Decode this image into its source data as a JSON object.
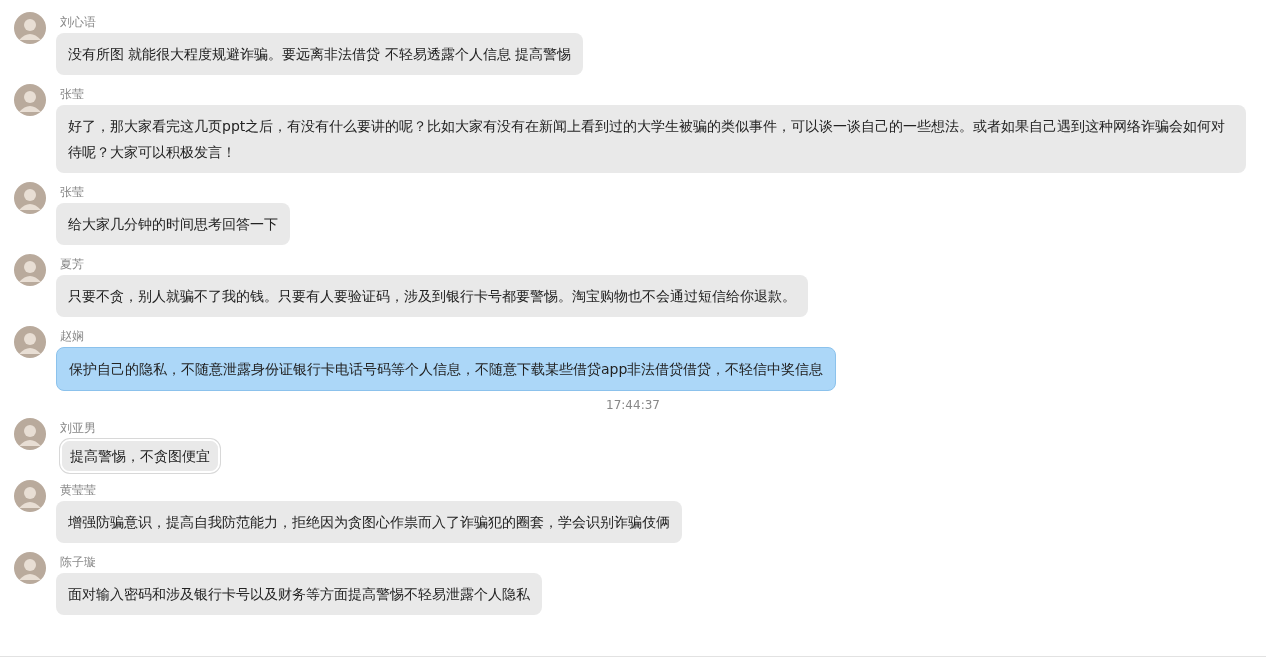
{
  "messages": [
    {
      "kind": "plain",
      "sender": "刘心语",
      "text": "没有所图 就能很大程度规避诈骗。要远离非法借贷 不轻易透露个人信息 提高警惕"
    },
    {
      "kind": "plain",
      "sender": "张莹",
      "text": "好了，那大家看完这几页ppt之后，有没有什么要讲的呢？比如大家有没有在新闻上看到过的大学生被骗的类似事件，可以谈一谈自己的一些想法。或者如果自己遇到这种网络诈骗会如何对待呢？大家可以积极发言！"
    },
    {
      "kind": "plain",
      "sender": "张莹",
      "text": "给大家几分钟的时间思考回答一下"
    },
    {
      "kind": "plain",
      "sender": "夏芳",
      "text": "只要不贪，别人就骗不了我的钱。只要有人要验证码，涉及到银行卡号都要警惕。淘宝购物也不会通过短信给你退款。"
    },
    {
      "kind": "cloud",
      "sender": "赵娴",
      "text": "保护自己的隐私，不随意泄露身份证银行卡电话号码等个人信息，不随意下载某些借贷app非法借贷借贷，不轻信中奖信息"
    },
    {
      "kind": "time",
      "text": "17:44:37"
    },
    {
      "kind": "sparkle",
      "sender": "刘亚男",
      "text": "提高警惕，不贪图便宜"
    },
    {
      "kind": "plain",
      "sender": "黄莹莹",
      "text": "增强防骗意识，提高自我防范能力，拒绝因为贪图心作祟而入了诈骗犯的圈套，学会识别诈骗伎俩"
    },
    {
      "kind": "plain",
      "sender": "陈子璇",
      "text": "面对输入密码和涉及银行卡号以及财务等方面提高警惕不轻易泄露个人隐私"
    }
  ]
}
